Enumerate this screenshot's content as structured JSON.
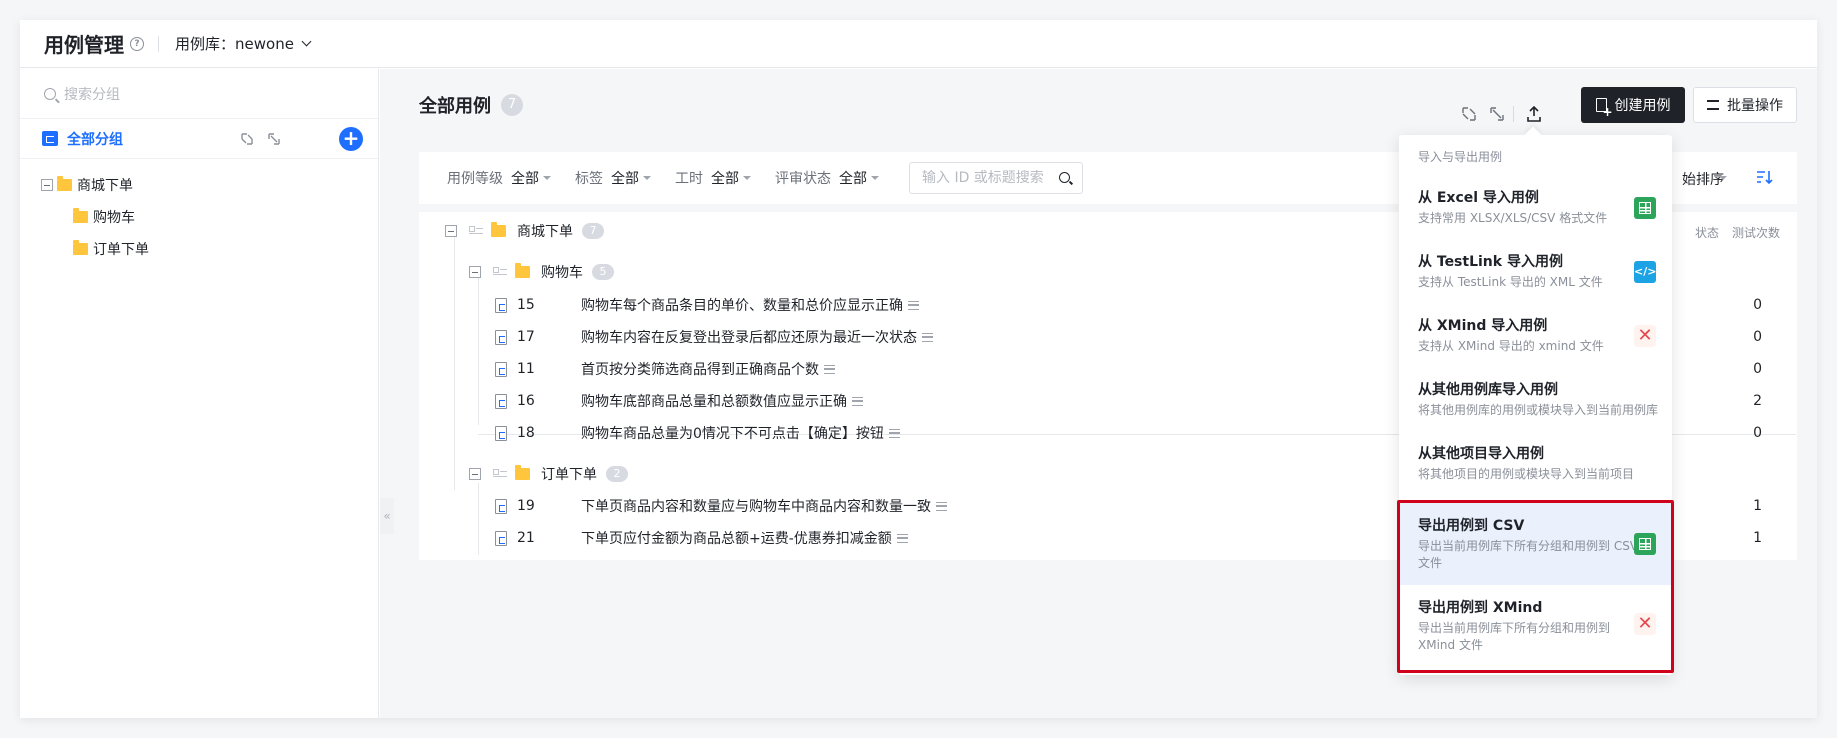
{
  "header": {
    "title": "用例管理",
    "help_icon": "?",
    "library_label": "用例库：",
    "library_value": "newone"
  },
  "sidebar": {
    "search_placeholder": "搜索分组",
    "all_groups_label": "全部分组",
    "add_icon": "+",
    "tree": [
      {
        "label": "商城下单",
        "level": 0
      },
      {
        "label": "购物车",
        "level": 1
      },
      {
        "label": "订单下单",
        "level": 1
      }
    ],
    "collapse_handle": "«"
  },
  "main": {
    "title": "全部用例",
    "total_count": "7",
    "create_button": "创建用例",
    "batch_button": "批量操作",
    "filters": [
      {
        "label": "用例等级",
        "value": "全部"
      },
      {
        "label": "标签",
        "value": "全部"
      },
      {
        "label": "工时",
        "value": "全部"
      },
      {
        "label": "评审状态",
        "value": "全部"
      }
    ],
    "search_placeholder": "输入 ID 或标题搜索",
    "sort_label": "始排序",
    "columns": {
      "status": "状态",
      "run_count": "测试次数"
    },
    "groups": [
      {
        "name": "商城下单",
        "count": "7"
      },
      {
        "name": "购物车",
        "count": "5"
      },
      {
        "name": "订单下单",
        "count": "2"
      }
    ],
    "cases": [
      {
        "id": "15",
        "title": "购物车每个商品条目的单价、数量和总价应显示正确",
        "runs": "0"
      },
      {
        "id": "17",
        "title": "购物车内容在反复登出登录后都应还原为最近一次状态",
        "runs": "0"
      },
      {
        "id": "11",
        "title": "首页按分类筛选商品得到正确商品个数",
        "runs": "0"
      },
      {
        "id": "16",
        "title": "购物车底部商品总量和总额数值应显示正确",
        "runs": "2"
      },
      {
        "id": "18",
        "title": "购物车商品总量为0情况下不可点击【确定】按钮",
        "runs": "0"
      },
      {
        "id": "19",
        "title": "下单页商品内容和数量应与购物车中商品内容和数量一致",
        "runs": "1"
      },
      {
        "id": "21",
        "title": "下单页应付金额为商品总额+运费-优惠券扣减金额",
        "runs": "1"
      }
    ]
  },
  "dropdown": {
    "header": "导入与导出用例",
    "items": [
      {
        "title": "从 Excel 导入用例",
        "desc": "支持常用 XLSX/XLS/CSV 格式文件",
        "icon": "excel-icon"
      },
      {
        "title": "从 TestLink 导入用例",
        "desc": "支持从 TestLink 导出的 XML 文件",
        "icon": "testlink-icon",
        "icon_glyph": "</>"
      },
      {
        "title": "从 XMind 导入用例",
        "desc": "支持从 XMind 导出的 xmind 文件",
        "icon": "xmind-icon",
        "icon_glyph": "✕"
      },
      {
        "title": "从其他用例库导入用例",
        "desc": "将其他用例库的用例或模块导入到当前用例库"
      },
      {
        "title": "从其他项目导入用例",
        "desc": "将其他项目的用例或模块导入到当前项目"
      },
      {
        "title": "导出用例到 CSV",
        "desc": "导出当前用例库下所有分组和用例到 CSV 文件",
        "icon": "excel-icon"
      },
      {
        "title": "导出用例到 XMind",
        "desc": "导出当前用例库下所有分组和用例到 XMind 文件",
        "icon": "xmind-icon",
        "icon_glyph": "✕"
      }
    ]
  },
  "colors": {
    "accent": "#1e6fff",
    "highlight": "#d0021b",
    "dark_button": "#1f2329"
  }
}
